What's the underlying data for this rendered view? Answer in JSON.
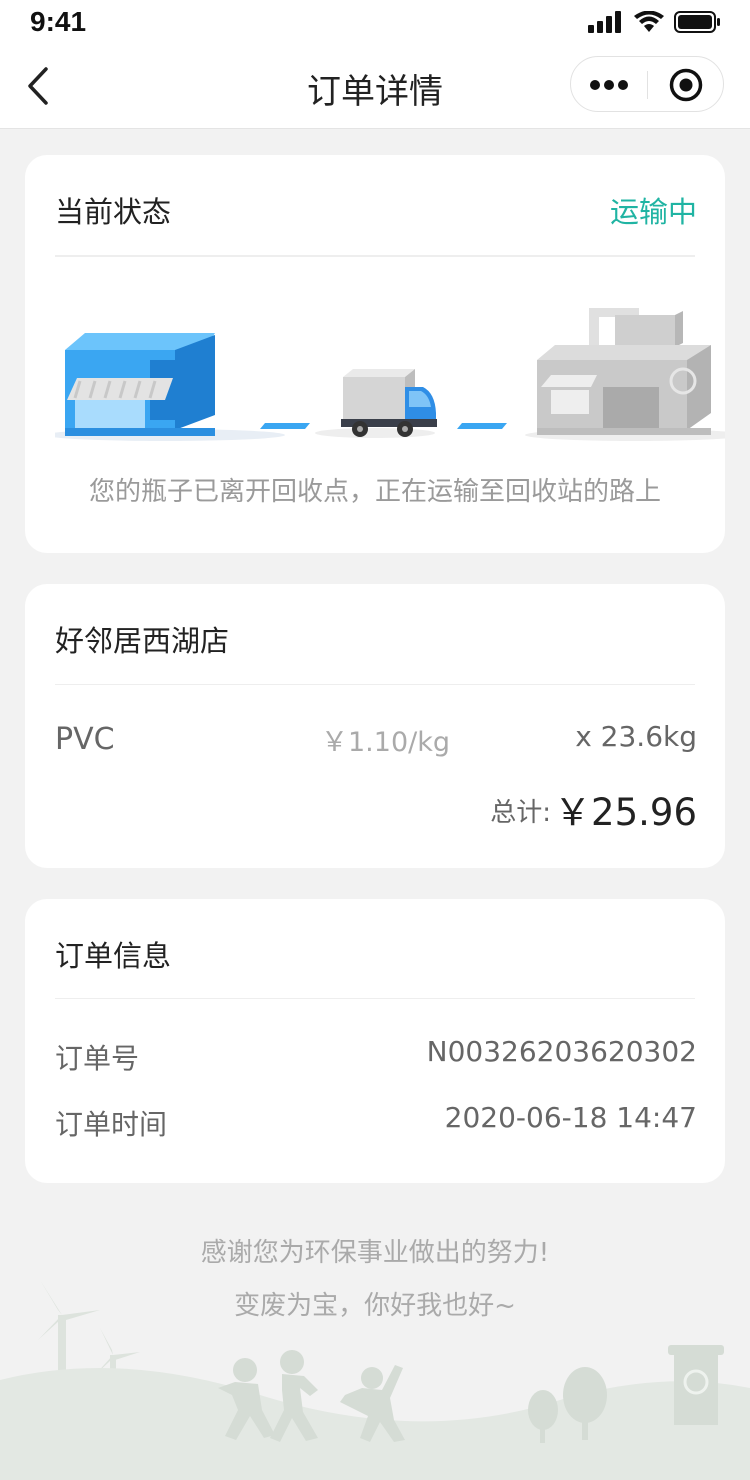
{
  "status_bar": {
    "time": "9:41"
  },
  "nav": {
    "title": "订单详情"
  },
  "status_card": {
    "title": "当前状态",
    "value": "运输中",
    "description": "您的瓶子已离开回收点，正在运输至回收站的路上"
  },
  "store_card": {
    "name": "好邻居西湖店",
    "item": {
      "material": "PVC",
      "unit_price": "￥1.10/kg",
      "quantity": "x 23.6kg"
    },
    "total_label": "总计:",
    "total_value": "￥25.96"
  },
  "order_info": {
    "title": "订单信息",
    "rows": [
      {
        "label": "订单号",
        "value": "N00326203620302"
      },
      {
        "label": "订单时间",
        "value": "2020-06-18 14:47"
      }
    ]
  },
  "footer": {
    "line1": "感谢您为环保事业做出的努力!",
    "line2": "变废为宝，你好我也好~"
  },
  "colors": {
    "accent": "#20b4a3",
    "background": "#f2f2f2",
    "store_blue": "#3aa6f2"
  },
  "icons": [
    "back-chevron-icon",
    "more-dots-icon",
    "close-target-icon",
    "signal-icon",
    "wifi-icon",
    "battery-icon"
  ]
}
